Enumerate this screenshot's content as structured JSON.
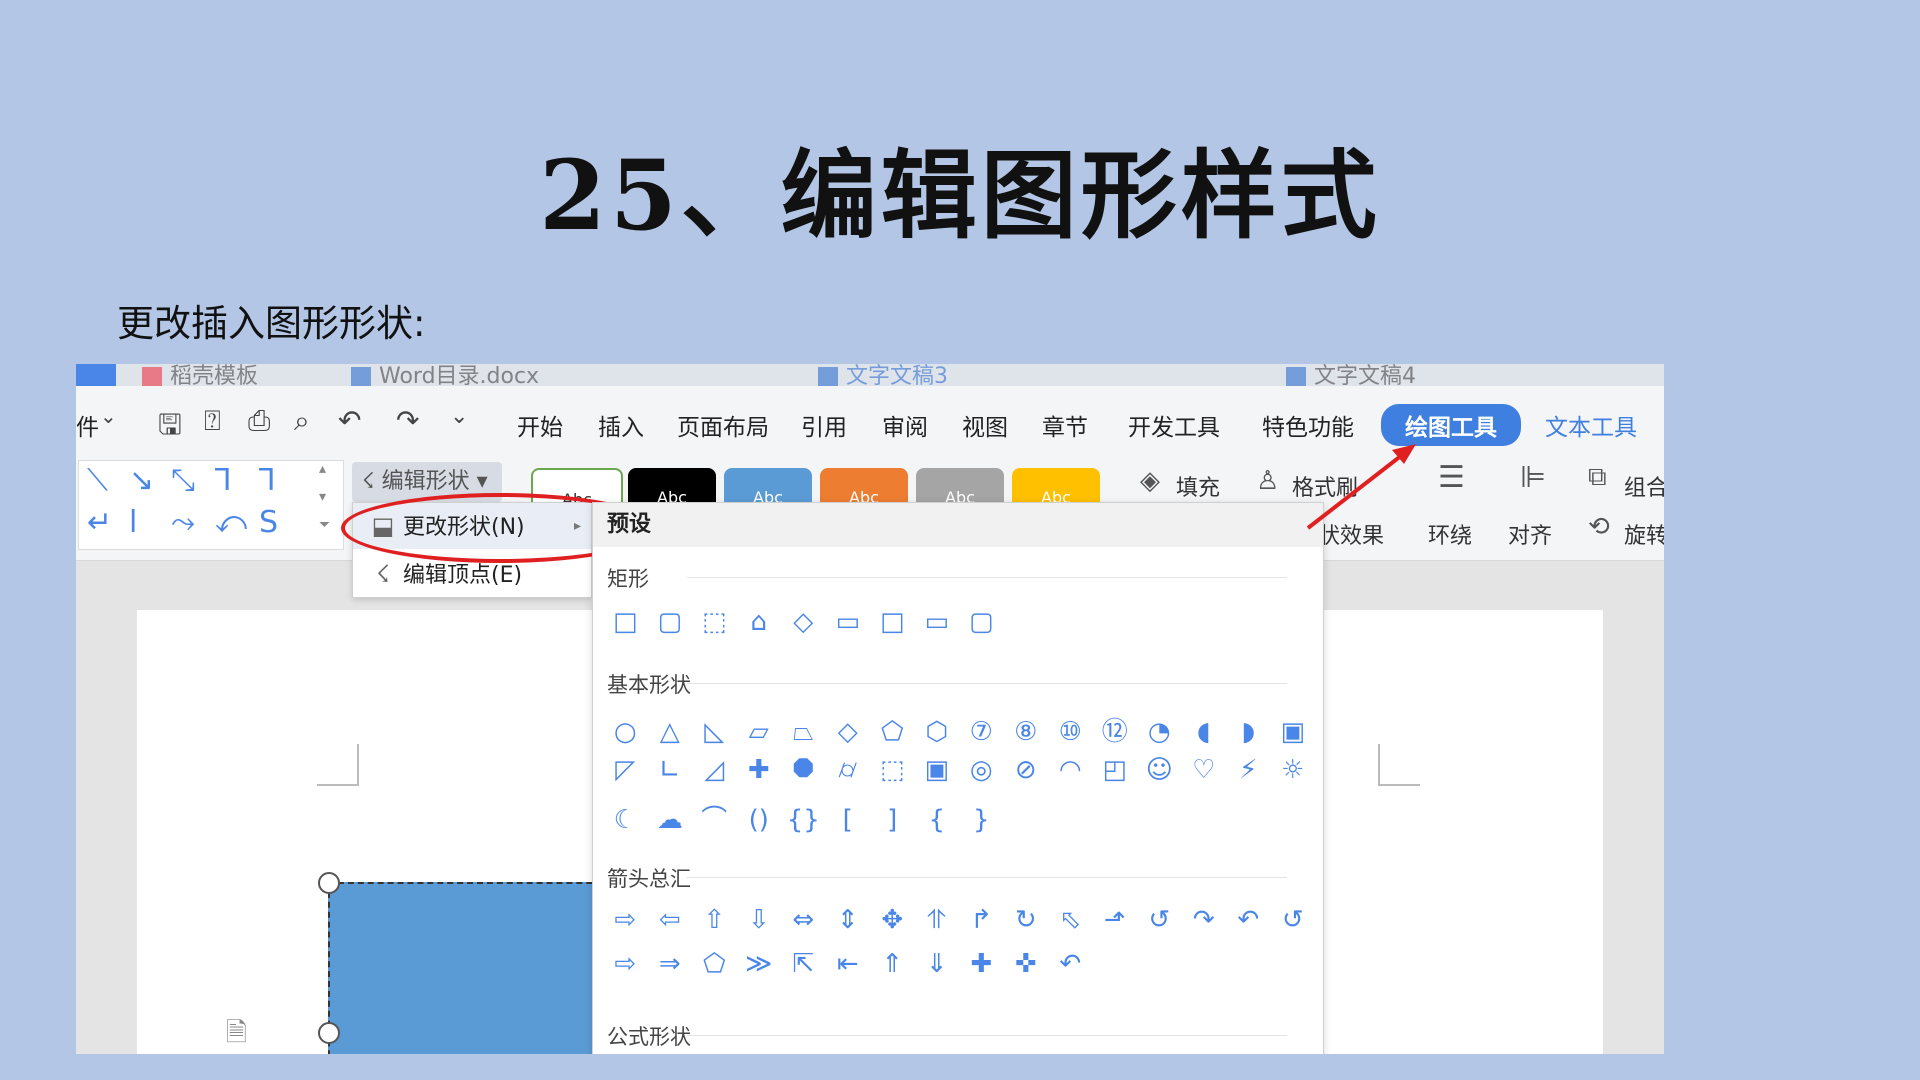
{
  "slide": {
    "title": "25、编辑图形样式",
    "subtitle": "更改插入图形形状:"
  },
  "tabs": [
    {
      "label": "稻壳模板"
    },
    {
      "label": "Word目录.docx"
    },
    {
      "label": "文字文稿3"
    },
    {
      "label": "文字文稿4"
    }
  ],
  "menubar": {
    "file_partial": "件",
    "items": [
      "开始",
      "插入",
      "页面布局",
      "引用",
      "审阅",
      "视图",
      "章节",
      "开发工具",
      "特色功能"
    ],
    "active": "绘图工具",
    "text_tools": "文本工具"
  },
  "ribbon": {
    "edit_shape": "编辑形状",
    "style_sample": "Abc",
    "fill": "填充",
    "format_brush": "格式刷",
    "shape_effect": "状效果",
    "wrap": "环绕",
    "align": "对齐",
    "group": "组合",
    "rotate": "旋转",
    "colors": {
      "accent": "#3f7fe0",
      "swatches": [
        "#ffffff",
        "#000000",
        "#5b9bd5",
        "#ed7d31",
        "#a5a5a5",
        "#ffc000"
      ]
    }
  },
  "context_menu": {
    "change_shape": "更改形状(N)",
    "edit_points": "编辑顶点(E)"
  },
  "shapes_dropdown": {
    "header": "预设",
    "sections": [
      "矩形",
      "基本形状",
      "箭头总汇",
      "公式形状"
    ],
    "rectangles": [
      "□",
      "▢",
      "⬚",
      "⌂",
      "◇",
      "▭",
      "□",
      "▭",
      "▢"
    ],
    "basic_row1": [
      "○",
      "△",
      "◺",
      "▱",
      "⏢",
      "◇",
      "⬠",
      "⬡",
      "⑦",
      "⑧",
      "⑩",
      "⑫",
      "◔",
      "◖",
      "◗",
      "▣"
    ],
    "basic_row2": [
      "◸",
      "∟",
      "◿",
      "✚",
      "⯃",
      "⌭",
      "⬚",
      "▣",
      "◎",
      "⊘",
      "◠",
      "◰",
      "☺",
      "♡",
      "⚡",
      "☼"
    ],
    "basic_row3": [
      "☾",
      "☁",
      "⌒",
      "()",
      "{}",
      "[",
      "]",
      "{",
      "}"
    ],
    "arrows_row1": [
      "⇨",
      "⇦",
      "⇧",
      "⇩",
      "⇔",
      "⇕",
      "✥",
      "⥣",
      "↱",
      "↻",
      "⬁",
      "⬏",
      "↺",
      "↷",
      "↶",
      "↺"
    ],
    "arrows_row2": [
      "⇨",
      "⇒",
      "⬠",
      "≫",
      "⇱",
      "⇤",
      "⇑",
      "⇓",
      "✚",
      "✜",
      "↶"
    ]
  }
}
